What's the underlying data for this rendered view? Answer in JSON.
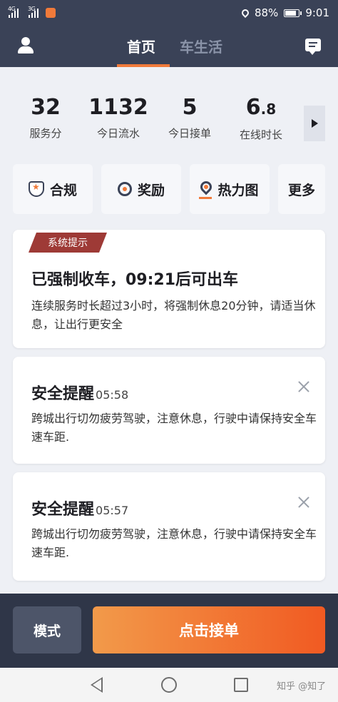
{
  "status_bar": {
    "network_1": "4G",
    "network_2": "3G",
    "battery": "88%",
    "battery_level": 0.88,
    "time": "9:01"
  },
  "header": {
    "tabs": [
      {
        "label": "首页",
        "active": true
      },
      {
        "label": "车生活",
        "active": false
      }
    ],
    "icons": {
      "left": "user-icon",
      "right": "message-icon"
    }
  },
  "stats": [
    {
      "value": "32",
      "label": "服务分"
    },
    {
      "value": "1132",
      "label": "今日流水"
    },
    {
      "value": "5",
      "label": "今日接单"
    },
    {
      "value_main": "6",
      "value_decimal": ".8",
      "label": "在线时长"
    }
  ],
  "quick_actions": [
    {
      "label": "合规",
      "icon": "shield-star-icon"
    },
    {
      "label": "奖励",
      "icon": "medal-icon"
    },
    {
      "label": "热力图",
      "icon": "location-pin-icon"
    },
    {
      "label": "更多"
    }
  ],
  "system_notice": {
    "tag": "系统提示",
    "title": "已强制收车，09:21后可出车",
    "body": "连续服务时长超过3小时，将强制休息20分钟，请适当休息，让出行更安全"
  },
  "safety_alerts": [
    {
      "title": "安全提醒",
      "time": "05:58",
      "body": "跨城出行切勿疲劳驾驶，注意休息，行驶中请保持安全车速车距."
    },
    {
      "title": "安全提醒",
      "time": "05:57",
      "body": "跨城出行切勿疲劳驾驶，注意休息，行驶中请保持安全车速车距."
    }
  ],
  "bottom": {
    "mode_label": "模式",
    "accept_label": "点击接单"
  },
  "watermark": "知乎 @知了",
  "colors": {
    "header_bg": "#3a4257",
    "accent": "#f07a3a",
    "tag_bg": "#9e3a36",
    "accept_gradient_start": "#f29a4a",
    "accept_gradient_end": "#f15a22"
  }
}
